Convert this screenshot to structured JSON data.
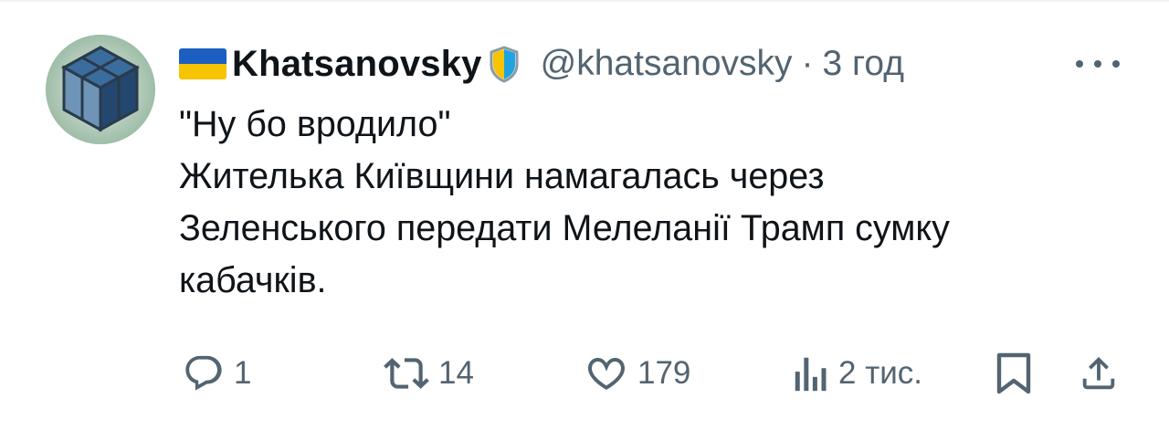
{
  "author": {
    "display_name": "Khatsanovsky",
    "handle": "@khatsanovsky",
    "separator": "·",
    "time": "3 год",
    "flag_icon": "ukraine-flag-icon",
    "badge_icon": "verified-shield-icon",
    "avatar": "geometric-cube-avatar"
  },
  "tweet": {
    "text": "\"Ну бо вродило\"\nЖителька Київщини намагалась через\nЗеленського передати Мелеланії Трамп сумку\nкабачків."
  },
  "actions": {
    "reply_count": "1",
    "retweet_count": "14",
    "like_count": "179",
    "views_count": "2 тис."
  },
  "colors": {
    "text": "#0f1419",
    "secondary": "#536471",
    "flag_blue": "#1b5fc1",
    "flag_yellow": "#f6c400"
  }
}
